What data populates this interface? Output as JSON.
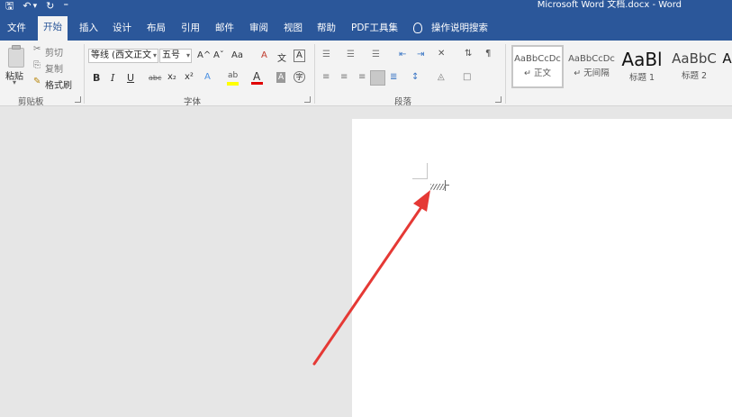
{
  "window": {
    "title": "Microsoft Word 文档.docx  -  Word"
  },
  "qat": {
    "save": "🖫",
    "undo": "↶",
    "undo_dd": "▾",
    "redo": "↻",
    "customize": "⁼"
  },
  "tabs": [
    {
      "label": "文件"
    },
    {
      "label": "开始"
    },
    {
      "label": "插入"
    },
    {
      "label": "设计"
    },
    {
      "label": "布局"
    },
    {
      "label": "引用"
    },
    {
      "label": "邮件"
    },
    {
      "label": "审阅"
    },
    {
      "label": "视图"
    },
    {
      "label": "帮助"
    },
    {
      "label": "PDF工具集"
    }
  ],
  "active_tab": "开始",
  "tell_me": "操作说明搜索",
  "clipboard": {
    "paste_label": "粘贴",
    "paste_dd": "▾",
    "cut": "剪切",
    "copy": "复制",
    "format_painter": "格式刷",
    "group_label": "剪贴板"
  },
  "font": {
    "family": "等线 (西文正文",
    "size": "五号",
    "group_label": "字体",
    "grow": "A^",
    "shrink": "Aˇ",
    "case": "Aa",
    "clear": "A",
    "phonetic": "文",
    "border": "A",
    "bold": "B",
    "italic": "I",
    "underline": "U",
    "strike": "abc",
    "subscript": "x₂",
    "superscript": "x²",
    "effects": "A",
    "highlight": "ab",
    "color": "A",
    "shading": "A",
    "enclose": "字",
    "colors": {
      "highlight": "#ffff00",
      "font_color": "#e00000"
    }
  },
  "paragraph": {
    "group_label": "段落"
  },
  "styles": [
    {
      "sample": "AaBbCcDc",
      "name": "↵ 正文"
    },
    {
      "sample": "AaBbCcDc",
      "name": "↵ 无间隔"
    },
    {
      "sample": "AaBl",
      "name": "标题 1"
    },
    {
      "sample": "AaBbC",
      "name": "标题 2"
    },
    {
      "sample": "A",
      "name": ""
    }
  ],
  "colors": {
    "ribbon_blue": "#2b579a",
    "arrow": "#e53935",
    "page": "#ffffff",
    "canvas": "#e6e6e6"
  }
}
